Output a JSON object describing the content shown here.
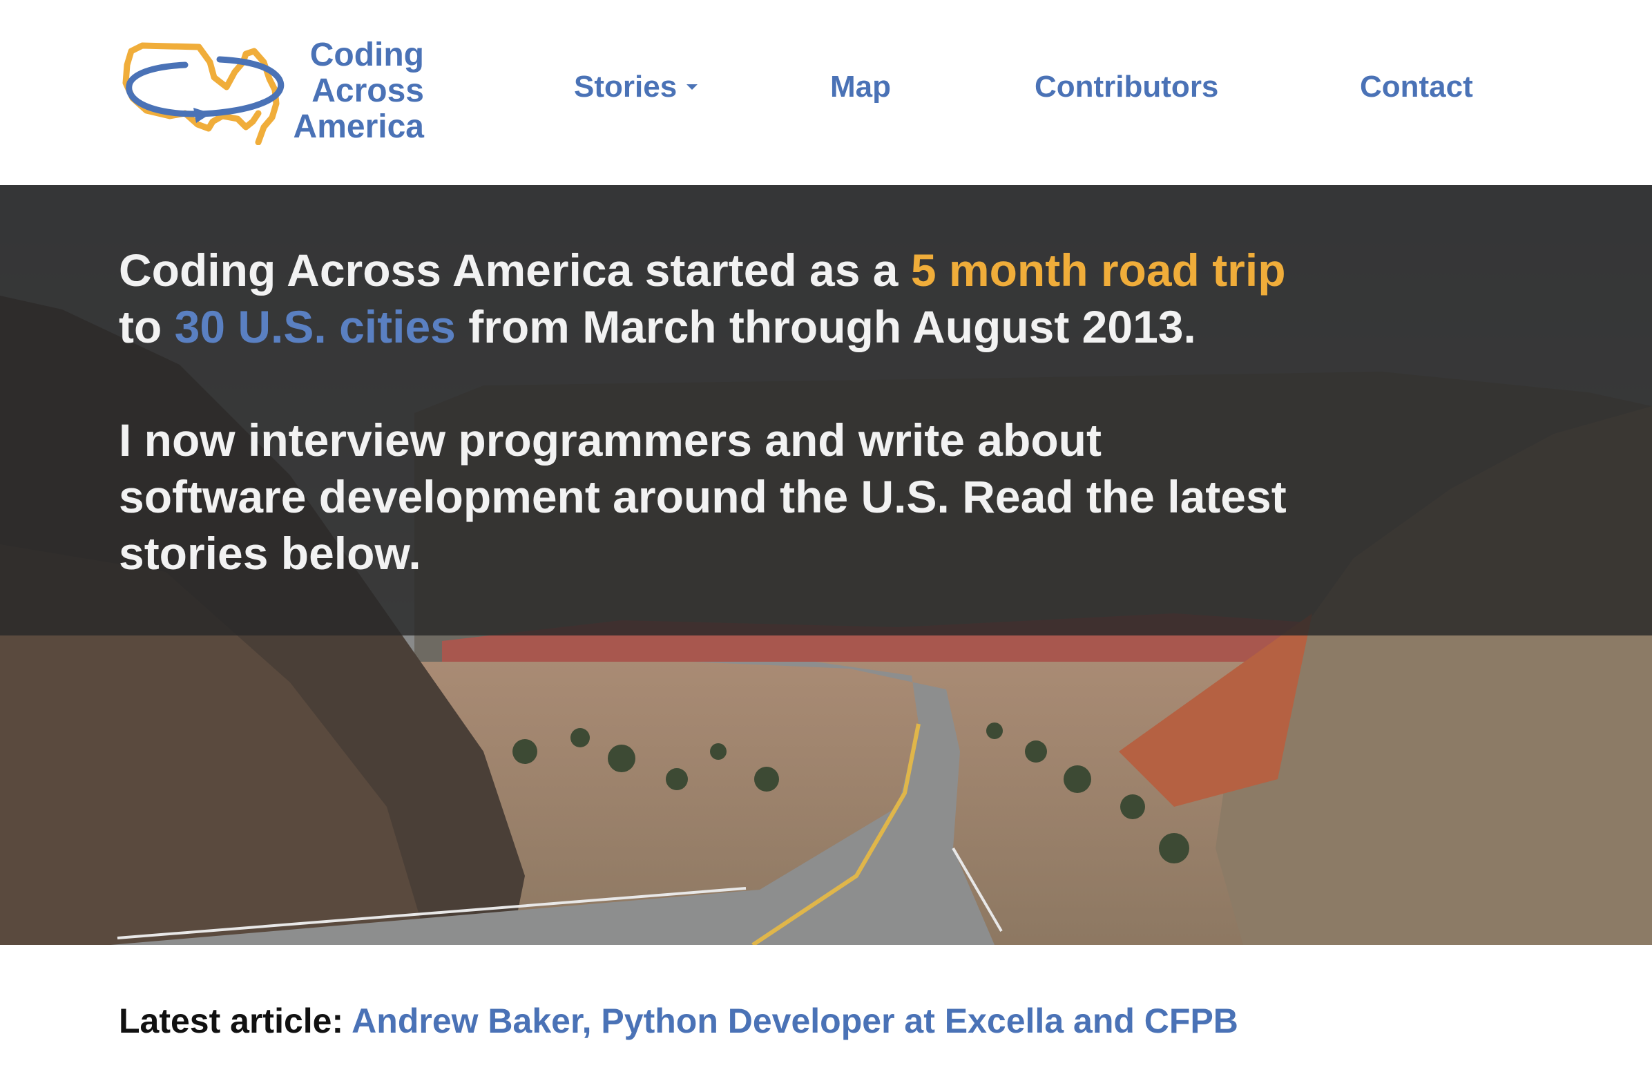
{
  "logo": {
    "line1": "Coding",
    "line2": "Across",
    "line3": "America"
  },
  "nav": {
    "stories": "Stories",
    "map": "Map",
    "contributors": "Contributors",
    "contact": "Contact"
  },
  "hero": {
    "p1_a": "Coding Across America started as a ",
    "p1_highlight1": "5 month road trip",
    "p1_b": " to ",
    "p1_highlight2": "30 U.S. cities",
    "p1_c": " from March through August 2013.",
    "p2_l1": "I now interview programmers and write about",
    "p2_l2": "software development around the U.S. Read the latest",
    "p2_l3": "stories below."
  },
  "latest": {
    "label": "Latest article:",
    "link": "Andrew Baker, Python Developer at Excella and CFPB"
  },
  "colors": {
    "brand_blue": "#4a72b6",
    "brand_orange": "#f0ad3a",
    "overlay": "#282828"
  }
}
